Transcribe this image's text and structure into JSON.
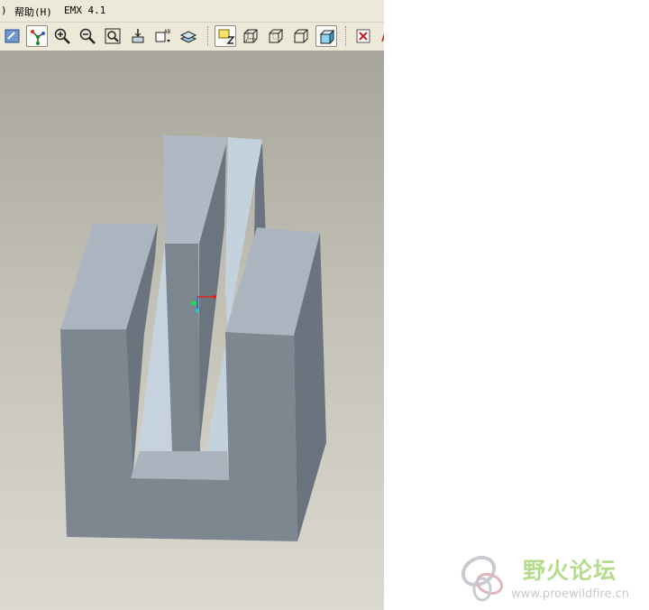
{
  "menubar": {
    "items": [
      {
        "label": ")"
      },
      {
        "label": "帮助(H)"
      },
      {
        "label": "EMX 4.1"
      }
    ]
  },
  "toolbar": {
    "tools": [
      {
        "icon": "redraw-icon",
        "active": false
      },
      {
        "icon": "spin-center-icon",
        "active": true
      },
      {
        "icon": "zoom-in-icon",
        "active": false
      },
      {
        "icon": "zoom-out-icon",
        "active": false
      },
      {
        "icon": "refit-icon",
        "active": false
      },
      {
        "icon": "reorient-icon",
        "active": false
      },
      {
        "icon": "saved-views-icon",
        "active": false
      },
      {
        "icon": "layers-icon",
        "active": false
      },
      {
        "icon": "datum-display-icon",
        "active": true
      },
      {
        "icon": "wireframe-icon",
        "active": false
      },
      {
        "icon": "hidden-line-icon",
        "active": false
      },
      {
        "icon": "no-hidden-icon",
        "active": false
      },
      {
        "icon": "shading-icon",
        "active": true
      },
      {
        "icon": "close-window-icon",
        "active": false
      }
    ]
  },
  "viewport": {
    "model": "3d-part-shaded",
    "colors": {
      "top_face": "#aab5c0",
      "front_face": "#7d8790",
      "side_face": "#66707a",
      "slot_face": "#c5d3df"
    }
  },
  "watermark": {
    "text": "野火论坛",
    "url": "www.proewildfire.cn"
  }
}
